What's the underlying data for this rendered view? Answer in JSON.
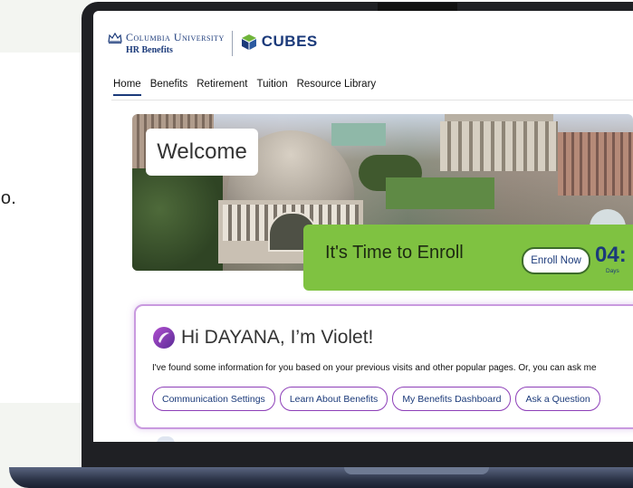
{
  "side": {
    "text_fragment": "ogo."
  },
  "header": {
    "university_name": "Columbia University",
    "university_sub": "HR Benefits",
    "product_name": "CUBES"
  },
  "nav": {
    "items": [
      "Home",
      "Benefits",
      "Retirement",
      "Tuition",
      "Resource Library"
    ],
    "active": "Home"
  },
  "hero": {
    "welcome": "Welcome",
    "enroll_title": "It's Time to Enroll",
    "enroll_button": "Enroll Now",
    "countdown_value": "04:",
    "countdown_unit": "Days"
  },
  "violet": {
    "greeting": "Hi DAYANA, I’m Violet!",
    "message": "I've found some information for you based on your previous visits and other popular pages. Or, you can ask me",
    "actions": [
      "Communication Settings",
      "Learn About Benefits",
      "My Benefits Dashboard",
      "Ask a Question"
    ]
  },
  "colors": {
    "brand_navy": "#1b3a7a",
    "enroll_green": "#7fc241",
    "violet_accent": "#8d3fb8"
  }
}
